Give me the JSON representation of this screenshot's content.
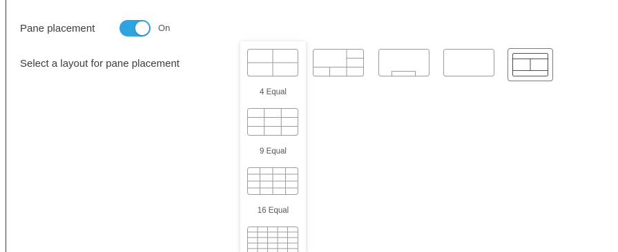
{
  "settings": {
    "pane_placement_label": "Pane placement",
    "toggle_state": "On",
    "toggle_color": "#2fa3e0",
    "layout_label": "Select a layout for pane placement"
  },
  "dropdown": {
    "options": [
      {
        "label": "4 Equal",
        "icon": "layout-4-equal-icon"
      },
      {
        "label": "9 Equal",
        "icon": "layout-9-equal-icon"
      },
      {
        "label": "16 Equal",
        "icon": "layout-16-equal-icon"
      },
      {
        "label": "",
        "icon": "layout-20-grid-icon"
      }
    ]
  },
  "layouts": [
    {
      "icon": "layout-1-plus-5-icon",
      "selected": false
    },
    {
      "icon": "layout-overlay-bottom-icon",
      "selected": false
    },
    {
      "icon": "layout-single-icon",
      "selected": false
    },
    {
      "icon": "layout-3-plus-1-icon",
      "selected": true
    }
  ]
}
